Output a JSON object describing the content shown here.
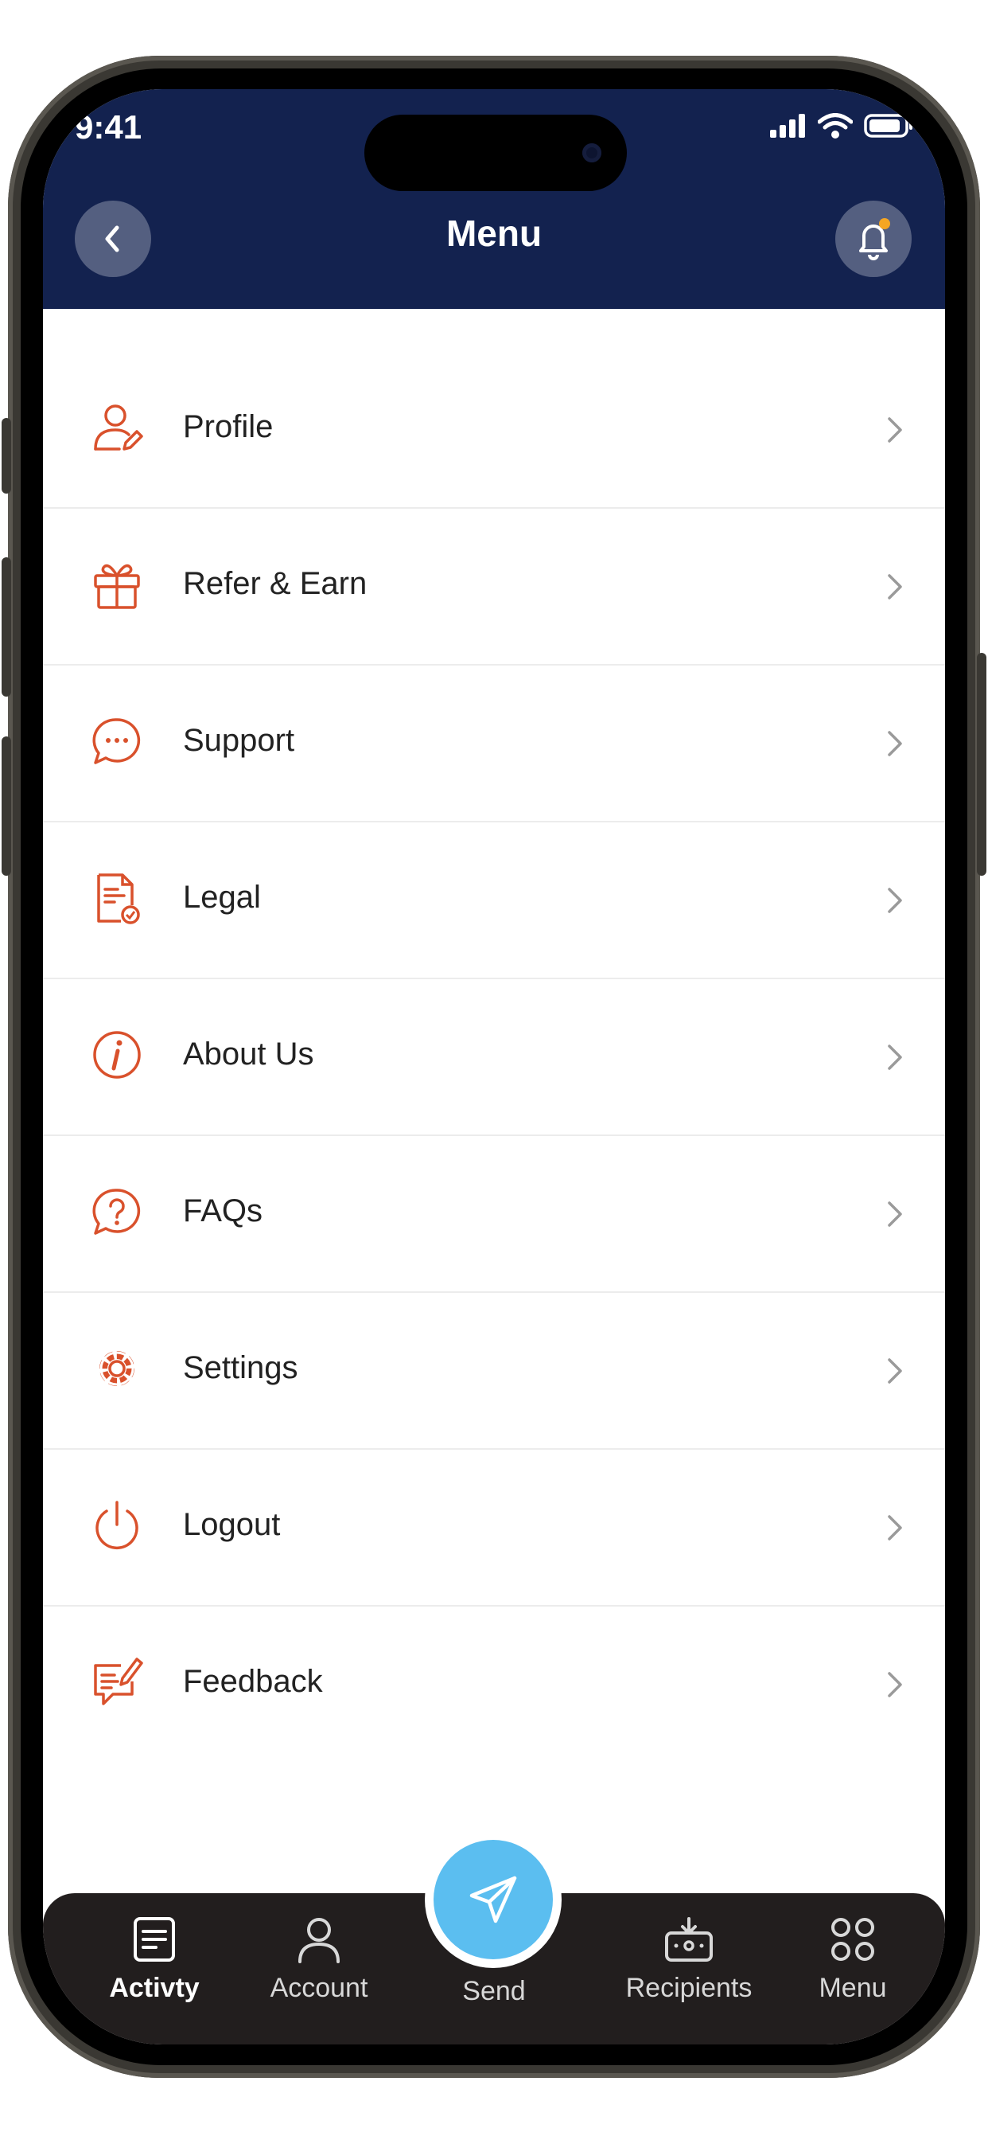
{
  "status_bar": {
    "time": "9:41"
  },
  "header": {
    "title": "Menu"
  },
  "colors": {
    "header_bg": "#13224f",
    "accent": "#d9512c",
    "send_button": "#5bbef0",
    "tabbar_bg": "#221e1e",
    "badge": "#f5a623"
  },
  "menu": {
    "items": [
      {
        "label": "Profile",
        "icon": "user-edit-icon"
      },
      {
        "label": "Refer & Earn",
        "icon": "gift-icon"
      },
      {
        "label": "Support",
        "icon": "chat-bubble-icon"
      },
      {
        "label": "Legal",
        "icon": "document-check-icon"
      },
      {
        "label": "About Us",
        "icon": "info-icon"
      },
      {
        "label": "FAQs",
        "icon": "question-bubble-icon"
      },
      {
        "label": "Settings",
        "icon": "gear-icon"
      },
      {
        "label": "Logout",
        "icon": "power-icon"
      },
      {
        "label": "Feedback",
        "icon": "feedback-icon"
      }
    ]
  },
  "tabbar": {
    "tabs": [
      {
        "label": "Activty",
        "icon": "document-icon",
        "active": true
      },
      {
        "label": "Account",
        "icon": "user-icon",
        "active": false
      },
      {
        "label": "Send",
        "icon": "paper-plane-icon",
        "active": false
      },
      {
        "label": "Recipients",
        "icon": "recipients-icon",
        "active": false
      },
      {
        "label": "Menu",
        "icon": "grid-icon",
        "active": false
      }
    ]
  }
}
